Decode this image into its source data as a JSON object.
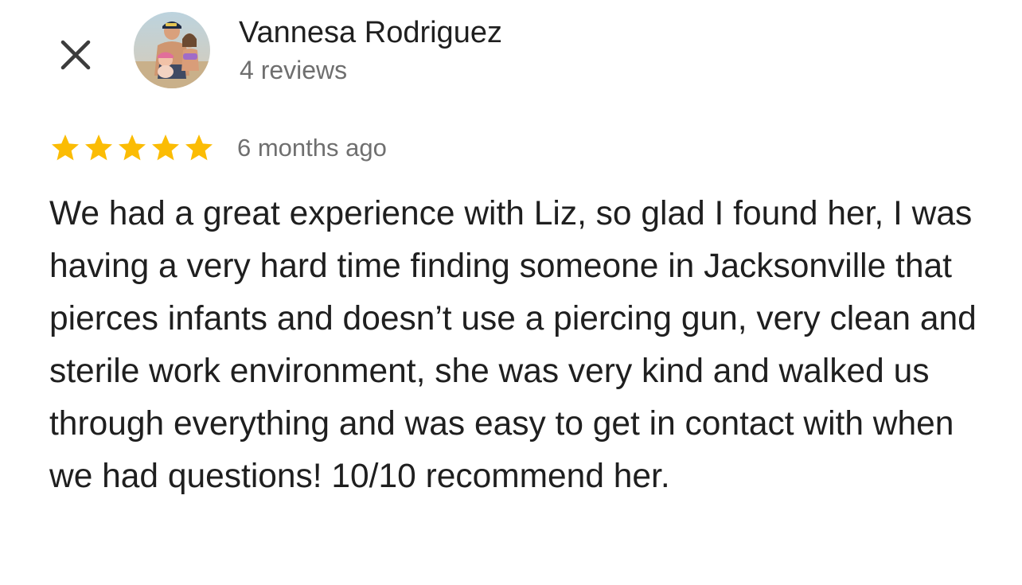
{
  "header": {
    "close_icon": "close-icon",
    "reviewer_name": "Vannesa Rodriguez",
    "review_count": "4 reviews",
    "avatar": "avatar-photo"
  },
  "review": {
    "rating": 5,
    "rating_max": 5,
    "star_icon": "star-icon",
    "star_color": "#fbbc04",
    "timestamp": "6 months ago",
    "text": "We had a great experience with Liz, so glad I found her, I was having a very hard time finding someone in Jacksonville that pierces infants and doesn’t use a piercing gun, very clean and sterile work environment, she was very kind and walked us through everything and was easy to get in contact with when we had questions! 10/10 recommend her."
  }
}
